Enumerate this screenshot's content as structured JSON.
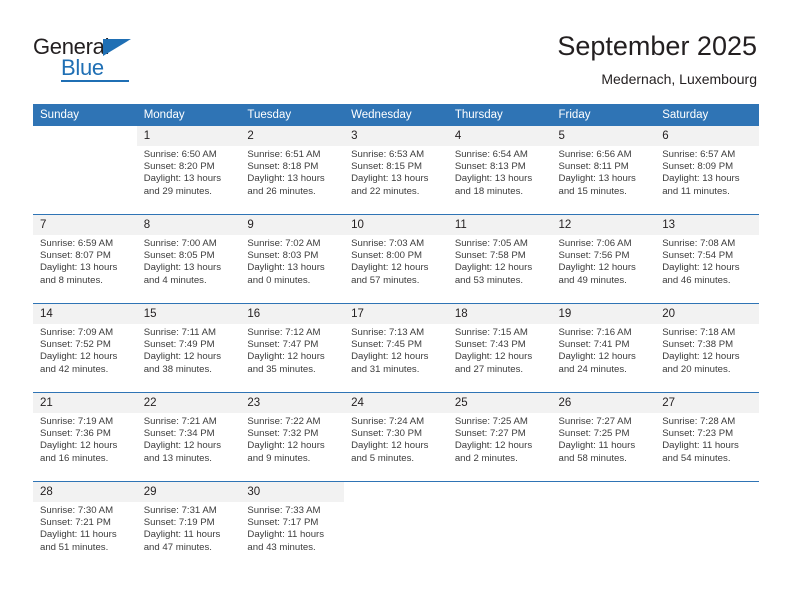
{
  "brand": {
    "name_part1": "General",
    "name_part2": "Blue",
    "triangle_icon": "triangle-icon",
    "accent_color": "#1f6fb4"
  },
  "header": {
    "title": "September 2025",
    "location": "Medernach, Luxembourg"
  },
  "calendar": {
    "header_color": "#2f74b5",
    "daynum_band_color": "#f2f2f2",
    "weekday_headers": [
      "Sunday",
      "Monday",
      "Tuesday",
      "Wednesday",
      "Thursday",
      "Friday",
      "Saturday"
    ],
    "weeks": [
      [
        {
          "day": "",
          "sunrise": "",
          "sunset": "",
          "daylight_line1": "",
          "daylight_line2": "",
          "blank": true
        },
        {
          "day": "1",
          "sunrise": "Sunrise: 6:50 AM",
          "sunset": "Sunset: 8:20 PM",
          "daylight_line1": "Daylight: 13 hours",
          "daylight_line2": "and 29 minutes."
        },
        {
          "day": "2",
          "sunrise": "Sunrise: 6:51 AM",
          "sunset": "Sunset: 8:18 PM",
          "daylight_line1": "Daylight: 13 hours",
          "daylight_line2": "and 26 minutes."
        },
        {
          "day": "3",
          "sunrise": "Sunrise: 6:53 AM",
          "sunset": "Sunset: 8:15 PM",
          "daylight_line1": "Daylight: 13 hours",
          "daylight_line2": "and 22 minutes."
        },
        {
          "day": "4",
          "sunrise": "Sunrise: 6:54 AM",
          "sunset": "Sunset: 8:13 PM",
          "daylight_line1": "Daylight: 13 hours",
          "daylight_line2": "and 18 minutes."
        },
        {
          "day": "5",
          "sunrise": "Sunrise: 6:56 AM",
          "sunset": "Sunset: 8:11 PM",
          "daylight_line1": "Daylight: 13 hours",
          "daylight_line2": "and 15 minutes."
        },
        {
          "day": "6",
          "sunrise": "Sunrise: 6:57 AM",
          "sunset": "Sunset: 8:09 PM",
          "daylight_line1": "Daylight: 13 hours",
          "daylight_line2": "and 11 minutes."
        }
      ],
      [
        {
          "day": "7",
          "sunrise": "Sunrise: 6:59 AM",
          "sunset": "Sunset: 8:07 PM",
          "daylight_line1": "Daylight: 13 hours",
          "daylight_line2": "and 8 minutes."
        },
        {
          "day": "8",
          "sunrise": "Sunrise: 7:00 AM",
          "sunset": "Sunset: 8:05 PM",
          "daylight_line1": "Daylight: 13 hours",
          "daylight_line2": "and 4 minutes."
        },
        {
          "day": "9",
          "sunrise": "Sunrise: 7:02 AM",
          "sunset": "Sunset: 8:03 PM",
          "daylight_line1": "Daylight: 13 hours",
          "daylight_line2": "and 0 minutes."
        },
        {
          "day": "10",
          "sunrise": "Sunrise: 7:03 AM",
          "sunset": "Sunset: 8:00 PM",
          "daylight_line1": "Daylight: 12 hours",
          "daylight_line2": "and 57 minutes."
        },
        {
          "day": "11",
          "sunrise": "Sunrise: 7:05 AM",
          "sunset": "Sunset: 7:58 PM",
          "daylight_line1": "Daylight: 12 hours",
          "daylight_line2": "and 53 minutes."
        },
        {
          "day": "12",
          "sunrise": "Sunrise: 7:06 AM",
          "sunset": "Sunset: 7:56 PM",
          "daylight_line1": "Daylight: 12 hours",
          "daylight_line2": "and 49 minutes."
        },
        {
          "day": "13",
          "sunrise": "Sunrise: 7:08 AM",
          "sunset": "Sunset: 7:54 PM",
          "daylight_line1": "Daylight: 12 hours",
          "daylight_line2": "and 46 minutes."
        }
      ],
      [
        {
          "day": "14",
          "sunrise": "Sunrise: 7:09 AM",
          "sunset": "Sunset: 7:52 PM",
          "daylight_line1": "Daylight: 12 hours",
          "daylight_line2": "and 42 minutes."
        },
        {
          "day": "15",
          "sunrise": "Sunrise: 7:11 AM",
          "sunset": "Sunset: 7:49 PM",
          "daylight_line1": "Daylight: 12 hours",
          "daylight_line2": "and 38 minutes."
        },
        {
          "day": "16",
          "sunrise": "Sunrise: 7:12 AM",
          "sunset": "Sunset: 7:47 PM",
          "daylight_line1": "Daylight: 12 hours",
          "daylight_line2": "and 35 minutes."
        },
        {
          "day": "17",
          "sunrise": "Sunrise: 7:13 AM",
          "sunset": "Sunset: 7:45 PM",
          "daylight_line1": "Daylight: 12 hours",
          "daylight_line2": "and 31 minutes."
        },
        {
          "day": "18",
          "sunrise": "Sunrise: 7:15 AM",
          "sunset": "Sunset: 7:43 PM",
          "daylight_line1": "Daylight: 12 hours",
          "daylight_line2": "and 27 minutes."
        },
        {
          "day": "19",
          "sunrise": "Sunrise: 7:16 AM",
          "sunset": "Sunset: 7:41 PM",
          "daylight_line1": "Daylight: 12 hours",
          "daylight_line2": "and 24 minutes."
        },
        {
          "day": "20",
          "sunrise": "Sunrise: 7:18 AM",
          "sunset": "Sunset: 7:38 PM",
          "daylight_line1": "Daylight: 12 hours",
          "daylight_line2": "and 20 minutes."
        }
      ],
      [
        {
          "day": "21",
          "sunrise": "Sunrise: 7:19 AM",
          "sunset": "Sunset: 7:36 PM",
          "daylight_line1": "Daylight: 12 hours",
          "daylight_line2": "and 16 minutes."
        },
        {
          "day": "22",
          "sunrise": "Sunrise: 7:21 AM",
          "sunset": "Sunset: 7:34 PM",
          "daylight_line1": "Daylight: 12 hours",
          "daylight_line2": "and 13 minutes."
        },
        {
          "day": "23",
          "sunrise": "Sunrise: 7:22 AM",
          "sunset": "Sunset: 7:32 PM",
          "daylight_line1": "Daylight: 12 hours",
          "daylight_line2": "and 9 minutes."
        },
        {
          "day": "24",
          "sunrise": "Sunrise: 7:24 AM",
          "sunset": "Sunset: 7:30 PM",
          "daylight_line1": "Daylight: 12 hours",
          "daylight_line2": "and 5 minutes."
        },
        {
          "day": "25",
          "sunrise": "Sunrise: 7:25 AM",
          "sunset": "Sunset: 7:27 PM",
          "daylight_line1": "Daylight: 12 hours",
          "daylight_line2": "and 2 minutes."
        },
        {
          "day": "26",
          "sunrise": "Sunrise: 7:27 AM",
          "sunset": "Sunset: 7:25 PM",
          "daylight_line1": "Daylight: 11 hours",
          "daylight_line2": "and 58 minutes."
        },
        {
          "day": "27",
          "sunrise": "Sunrise: 7:28 AM",
          "sunset": "Sunset: 7:23 PM",
          "daylight_line1": "Daylight: 11 hours",
          "daylight_line2": "and 54 minutes."
        }
      ],
      [
        {
          "day": "28",
          "sunrise": "Sunrise: 7:30 AM",
          "sunset": "Sunset: 7:21 PM",
          "daylight_line1": "Daylight: 11 hours",
          "daylight_line2": "and 51 minutes."
        },
        {
          "day": "29",
          "sunrise": "Sunrise: 7:31 AM",
          "sunset": "Sunset: 7:19 PM",
          "daylight_line1": "Daylight: 11 hours",
          "daylight_line2": "and 47 minutes."
        },
        {
          "day": "30",
          "sunrise": "Sunrise: 7:33 AM",
          "sunset": "Sunset: 7:17 PM",
          "daylight_line1": "Daylight: 11 hours",
          "daylight_line2": "and 43 minutes."
        },
        {
          "day": "",
          "sunrise": "",
          "sunset": "",
          "daylight_line1": "",
          "daylight_line2": "",
          "blank": true
        },
        {
          "day": "",
          "sunrise": "",
          "sunset": "",
          "daylight_line1": "",
          "daylight_line2": "",
          "blank": true
        },
        {
          "day": "",
          "sunrise": "",
          "sunset": "",
          "daylight_line1": "",
          "daylight_line2": "",
          "blank": true
        },
        {
          "day": "",
          "sunrise": "",
          "sunset": "",
          "daylight_line1": "",
          "daylight_line2": "",
          "blank": true
        }
      ]
    ]
  }
}
